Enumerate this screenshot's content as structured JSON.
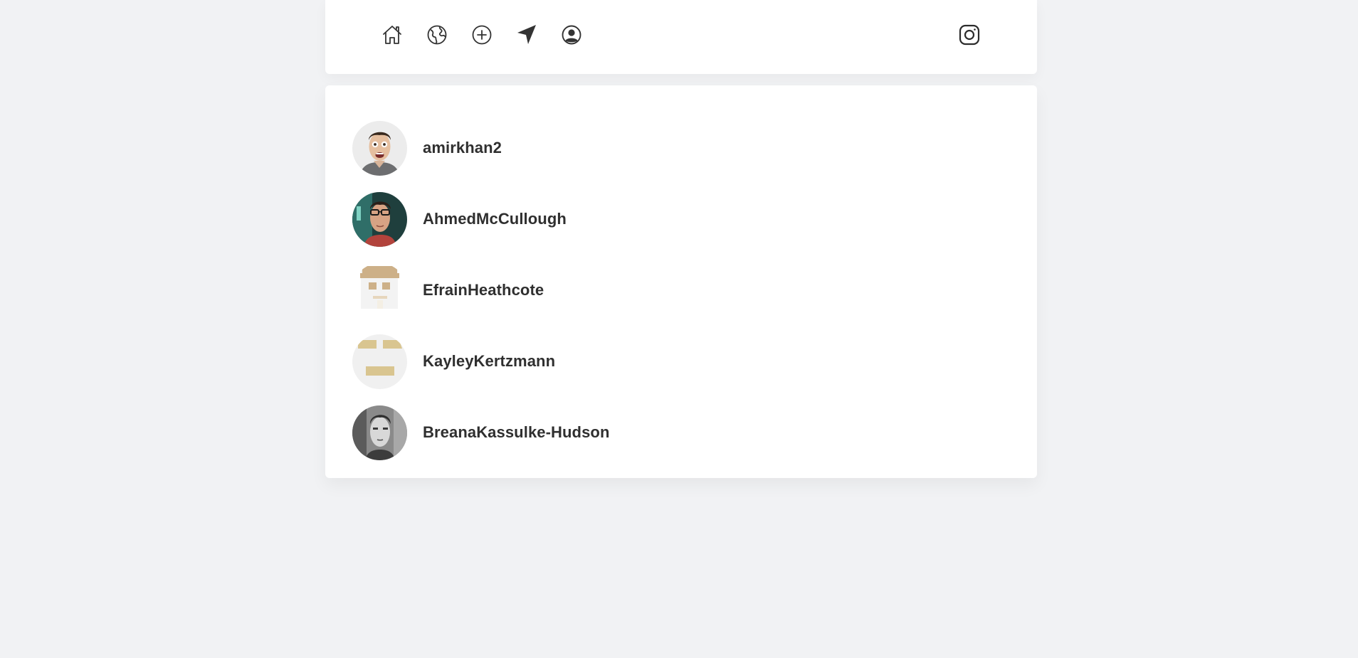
{
  "nav": {
    "icons": [
      "home-icon",
      "globe-icon",
      "plus-circle-icon",
      "navigation-arrow-icon",
      "user-circle-icon"
    ],
    "brand_icon": "instagram-icon"
  },
  "users": [
    {
      "username": "amirkhan2",
      "avatar": "photo-surprised-man"
    },
    {
      "username": "AhmedMcCullough",
      "avatar": "photo-man-glasses"
    },
    {
      "username": "EfrainHeathcote",
      "avatar": "pixel-identicon-hat"
    },
    {
      "username": "KayleyKertzmann",
      "avatar": "pixel-identicon-bars"
    },
    {
      "username": "BreanaKassulke-Hudson",
      "avatar": "photo-bw-man"
    }
  ],
  "colors": {
    "background": "#f1f2f4",
    "card": "#ffffff",
    "text": "#2f2f2f",
    "icon": "#333333",
    "identicon_tan": "#cdb088",
    "identicon_gold": "#d9c590"
  }
}
